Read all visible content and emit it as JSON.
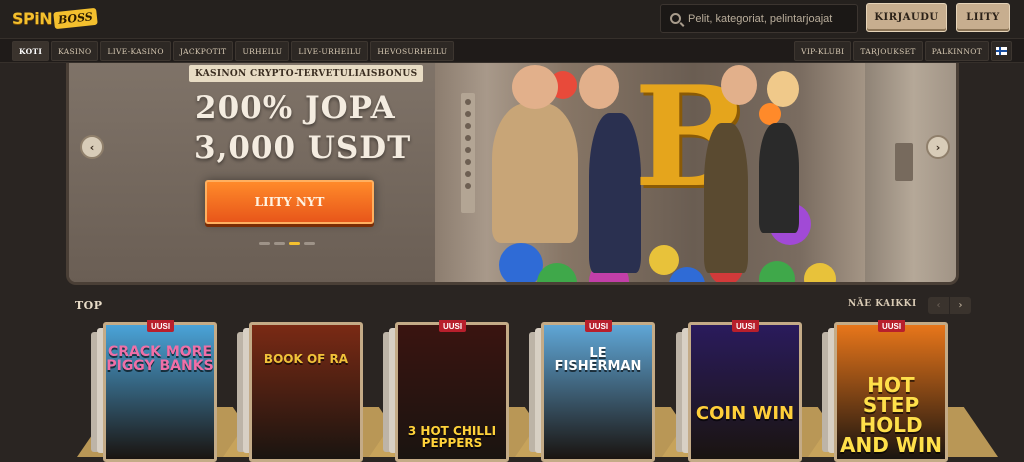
{
  "header": {
    "logo_main": "SPiN",
    "logo_sub": "BOSS",
    "search_placeholder": "Pelit, kategoriat, pelintarjoajat",
    "login_label": "KIRJAUDU",
    "join_label": "LIITY"
  },
  "nav": {
    "left": [
      "KOTI",
      "KASINO",
      "LIVE-KASINO",
      "JACKPOTIT",
      "URHEILU",
      "LIVE-URHEILU",
      "HEVOSURHEILU"
    ],
    "right": [
      "VIP-KLUBI",
      "TARJOUKSET",
      "PALKINNOT"
    ],
    "active": "KOTI",
    "flag_icon": "finland-flag-icon"
  },
  "hero": {
    "tag": "KASINON CRYPTO-TERVETULIAISBONUS",
    "line1": "200% JOPA",
    "line2": "3,000 USDT",
    "cta_label": "LIITY NYT",
    "coin_glyph": "B",
    "slide_count": 4,
    "active_slide": 2,
    "prev_arrow": "‹",
    "next_arrow": "›"
  },
  "top": {
    "title": "TOP",
    "see_all": "NÄE KAIKKI",
    "prev": "‹",
    "next": "›",
    "games": [
      {
        "title": "CRACK MORE PIGGY BANKS",
        "badge": "UUSI",
        "bg": "#4aa3d8",
        "color": "#f06fa7"
      },
      {
        "title": "BOOK OF RA",
        "badge": "",
        "bg": "#7a2a14",
        "color": "#f1c23a"
      },
      {
        "title": "3 HOT CHILLI PEPPERS",
        "badge": "UUSI",
        "bg": "#3a1410",
        "color": "#ffd23a"
      },
      {
        "title": "LE FISHERMAN",
        "badge": "UUSI",
        "bg": "#5fa6d6",
        "color": "#ffffff"
      },
      {
        "title": "COIN WIN",
        "badge": "UUSI",
        "bg": "#2a1b5c",
        "color": "#ffcf3a"
      },
      {
        "title": "HOT STEP HOLD AND WIN",
        "badge": "UUSI",
        "bg": "#e8761a",
        "color": "#ffe04a"
      }
    ]
  }
}
